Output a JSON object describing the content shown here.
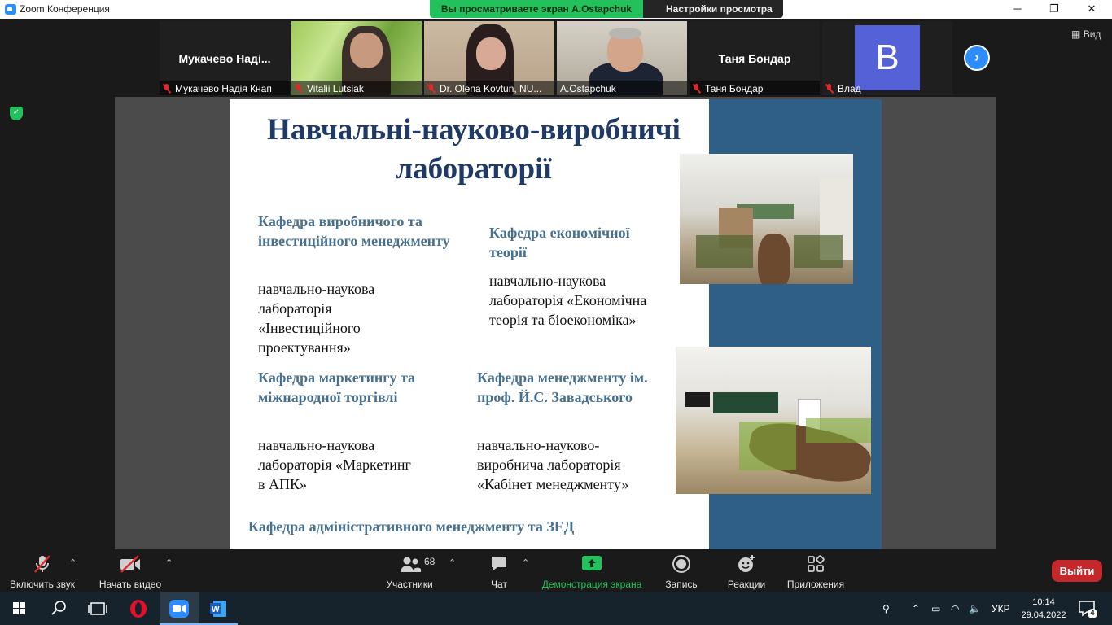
{
  "window": {
    "title": "Zoom Конференция",
    "minimize": "─",
    "restore": "❐",
    "close": "✕"
  },
  "share_banner": {
    "status": "Вы просматриваете экран A.Ostapchuk",
    "view_options": "Настройки просмотра ⌄"
  },
  "participants_strip": [
    {
      "big_name": "Мукачево  Наді...",
      "label": "Мукачево Надія Кнап",
      "muted": true
    },
    {
      "label": "Vitalii Lutsiak",
      "muted": true
    },
    {
      "label": "Dr. Olena Kovtun, NU...",
      "muted": true
    },
    {
      "label": "A.Ostapchuk",
      "muted": false,
      "active": true
    },
    {
      "big_name": "Таня Бондар",
      "label": "Таня Бондар",
      "muted": true
    },
    {
      "avatar_letter": "B",
      "label": "Влад",
      "muted": true
    }
  ],
  "view_button": "Вид",
  "slide": {
    "title": "Навчальні-науково-виробничі лабораторії",
    "blocks": [
      {
        "dept": "Кафедра виробничого та інвестиційного менеджменту",
        "lab": "навчально-наукова лабораторія «Інвестиційного проектування»"
      },
      {
        "dept": "Кафедра економічної теорії",
        "lab": "навчально-наукова лабораторія «Економічна теорія та біоекономіка»"
      },
      {
        "dept": "Кафедра маркетингу та міжнародної торгівлі",
        "lab": "навчально-наукова лабораторія «Маркетинг в АПК»"
      },
      {
        "dept": "Кафедра менеджменту ім. проф. Й.С. Завадського",
        "lab": "навчально-науково-виробнича лабораторія «Кабінет менеджменту»"
      },
      {
        "dept": "Кафедра адміністративного менеджменту та ЗЕД"
      }
    ]
  },
  "toolbar": {
    "unmute": "Включить звук",
    "start_video": "Начать видео",
    "participants": "Участники",
    "participants_count": "68",
    "chat": "Чат",
    "share_screen": "Демонстрация экрана",
    "record": "Запись",
    "reactions": "Реакции",
    "apps": "Приложения",
    "leave": "Выйти"
  },
  "taskbar": {
    "language": "УКР",
    "time": "10:14",
    "date": "29.04.2022",
    "notifications": "4"
  },
  "colors": {
    "zoom_blue": "#2d8cff",
    "share_green": "#23c15c",
    "leave_red": "#c5282a",
    "slide_title": "#1f3a66",
    "slide_dept": "#47708f",
    "slide_bar": "#2f5f87"
  }
}
